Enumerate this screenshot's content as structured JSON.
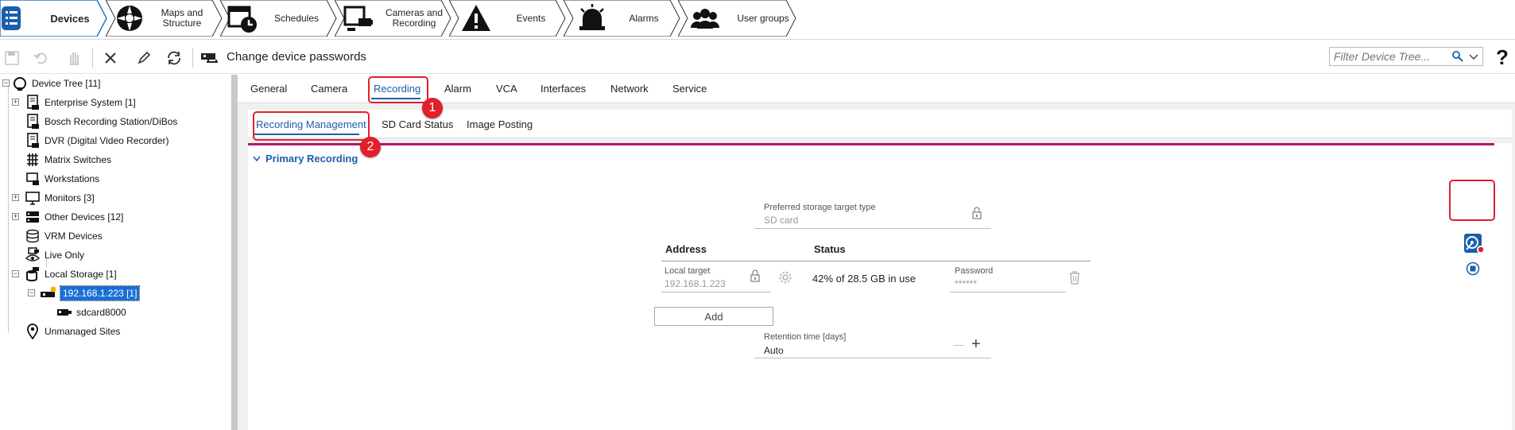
{
  "nav": {
    "tabs": [
      {
        "label": "Devices",
        "icon": "devices-icon",
        "active": true
      },
      {
        "label": "Maps and Structure",
        "icon": "maps-structure-icon"
      },
      {
        "label": "Schedules",
        "icon": "schedules-icon"
      },
      {
        "label": "Cameras and Recording",
        "icon": "cameras-recording-icon"
      },
      {
        "label": "Events",
        "icon": "events-warning-icon"
      },
      {
        "label": "Alarms",
        "icon": "alarm-bell-icon"
      },
      {
        "label": "User groups",
        "icon": "user-groups-icon"
      }
    ]
  },
  "toolbar": {
    "title": "Change device passwords",
    "filter_placeholder": "Filter Device Tree...",
    "help": "?"
  },
  "tree": {
    "items": [
      {
        "label": "Device Tree [11]",
        "icon": "device-tree-icon"
      },
      {
        "label": "Enterprise System [1]",
        "icon": "enterprise-system-icon"
      },
      {
        "label": "Bosch Recording Station/DiBos",
        "icon": "recording-station-icon"
      },
      {
        "label": "DVR (Digital Video Recorder)",
        "icon": "dvr-icon"
      },
      {
        "label": "Matrix Switches",
        "icon": "matrix-switch-icon"
      },
      {
        "label": "Workstations",
        "icon": "workstation-icon"
      },
      {
        "label": "Monitors [3]",
        "icon": "monitor-icon"
      },
      {
        "label": "Other Devices [12]",
        "icon": "other-devices-icon"
      },
      {
        "label": "VRM Devices",
        "icon": "vrm-devices-icon"
      },
      {
        "label": "Live Only",
        "icon": "live-only-icon"
      },
      {
        "label": "Local Storage [1]",
        "icon": "local-storage-icon"
      },
      {
        "label": "192.168.1.223 [1]",
        "icon": "encoder-icon"
      },
      {
        "label": "sdcard8000",
        "icon": "camera-device-icon"
      },
      {
        "label": "Unmanaged Sites",
        "icon": "location-pin-icon"
      }
    ]
  },
  "tabs_main": [
    "General",
    "Camera",
    "Recording",
    "Alarm",
    "VCA",
    "Interfaces",
    "Network",
    "Service"
  ],
  "tabs_sub": [
    "Recording Management",
    "SD Card Status",
    "Image Posting"
  ],
  "section": {
    "title": "Primary Recording"
  },
  "storage": {
    "preferred_label": "Preferred storage target type",
    "preferred_value": "SD card",
    "col_address": "Address",
    "col_status": "Status",
    "local_target_label": "Local target",
    "local_target_value": "192.168.1.223",
    "status_value": "42% of 28.5 GB in use",
    "password_label": "Password",
    "password_value": "******",
    "add_label": "Add",
    "retention_label": "Retention time [days]",
    "retention_value": "Auto",
    "minus": "—",
    "plus": "+"
  },
  "annotations": [
    "1",
    "2"
  ],
  "colors": {
    "accent": "#1a5fa8",
    "magenta": "#b5166b",
    "highlight": "#e0202a",
    "selected": "#1a6fd6"
  }
}
